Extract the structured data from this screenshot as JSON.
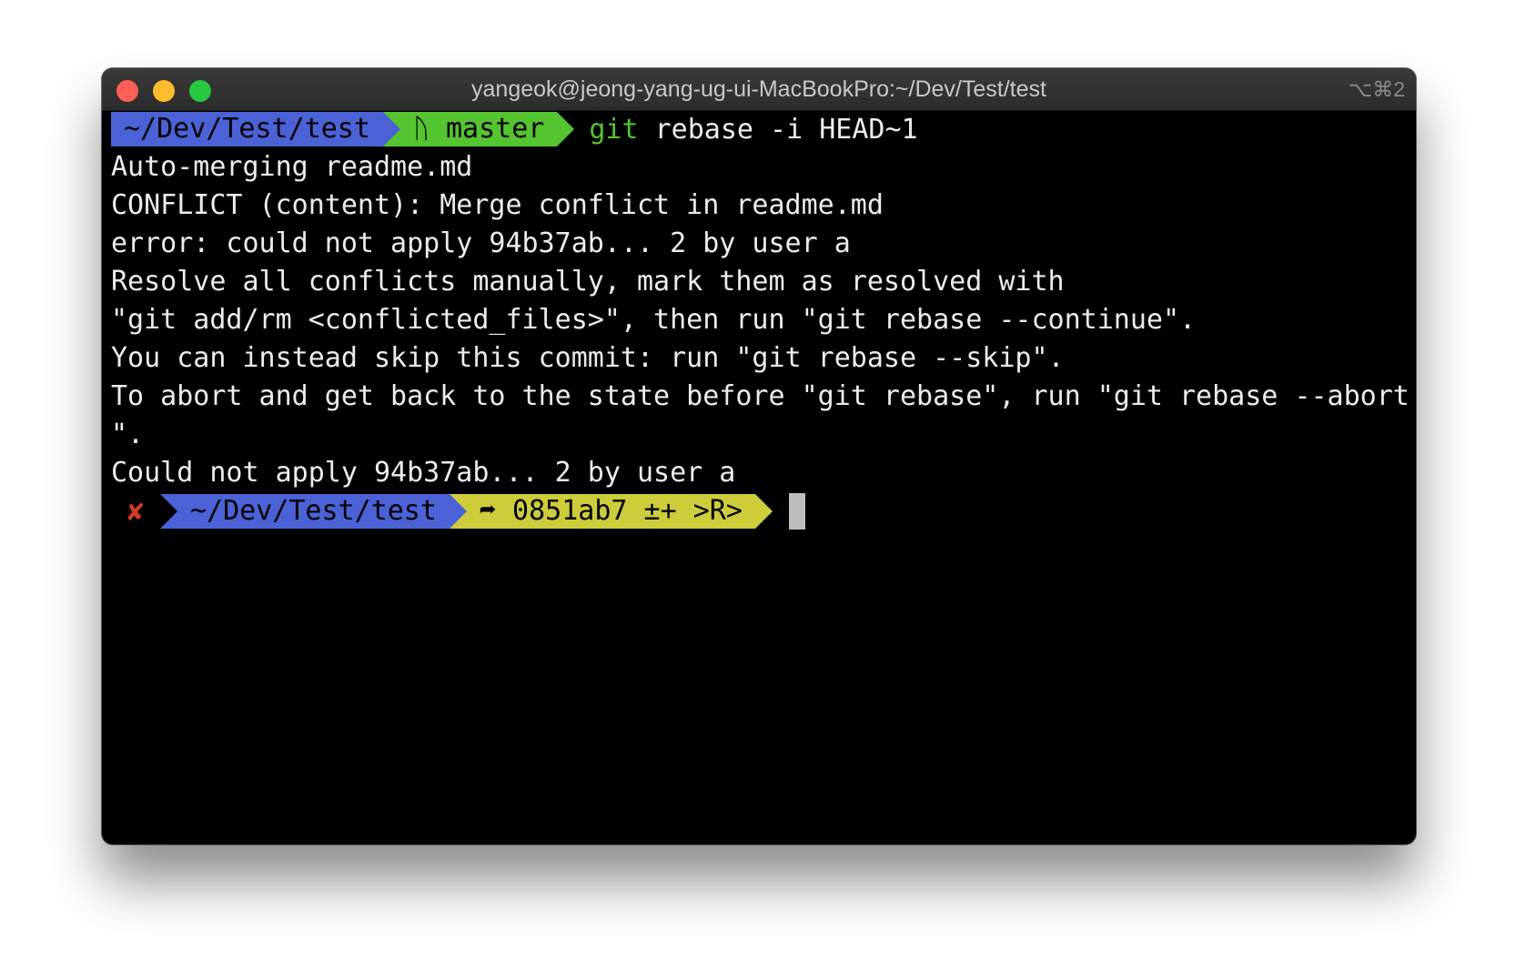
{
  "window": {
    "title": "yangeok@jeong-yang-ug-ui-MacBookPro:~/Dev/Test/test",
    "shortcut": "⌥⌘2"
  },
  "prompt1": {
    "path": "~/Dev/Test/test",
    "branch_icon": "ᚢ",
    "branch": "master",
    "cmd_head": "git",
    "cmd_rest": " rebase -i HEAD~1"
  },
  "output": [
    "Auto-merging readme.md",
    "CONFLICT (content): Merge conflict in readme.md",
    "error: could not apply 94b37ab... 2 by user a",
    "Resolve all conflicts manually, mark them as resolved with",
    "\"git add/rm <conflicted_files>\", then run \"git rebase --continue\".",
    "You can instead skip this commit: run \"git rebase --skip\".",
    "To abort and get back to the state before \"git rebase\", run \"git rebase --abort",
    "\".",
    "Could not apply 94b37ab... 2 by user a"
  ],
  "prompt2": {
    "status_icon": "✘",
    "path": "~/Dev/Test/test",
    "git_info": "➦ 0851ab7 ±+ >R>"
  },
  "colors": {
    "segment_blue": "#4b61d6",
    "segment_green": "#54c431",
    "segment_yellow": "#cdcd3c",
    "error_red": "#d23a2a"
  }
}
